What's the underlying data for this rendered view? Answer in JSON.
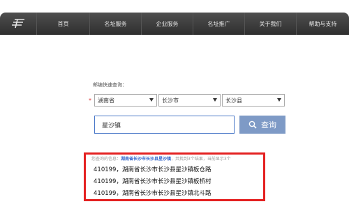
{
  "nav": {
    "items": [
      "首页",
      "名址服务",
      "企业服务",
      "名址推广",
      "关于我们",
      "帮助与支持"
    ]
  },
  "query": {
    "label": "邮编快速查询：",
    "province": "湖南省",
    "city": "长沙市",
    "county": "长沙县",
    "search_value": "星沙镇",
    "search_button": "查询"
  },
  "result_info": {
    "prefix": "您查询的信息：",
    "keyword": "湖南省长沙市长沙县星沙镇",
    "suffix": "，共找到3个结果，当前显示3个"
  },
  "results": [
    "410199，湖南省长沙市长沙县星沙镇板仓路",
    "410199，湖南省长沙市长沙县星沙镇板桥村",
    "410199，湖南省长沙市长沙县星沙镇北斗路"
  ],
  "colors": {
    "navbar": "#3a3a3a",
    "search_button": "#7e9ac6",
    "highlight_border": "#e42121",
    "input_border": "#4a78c8"
  }
}
